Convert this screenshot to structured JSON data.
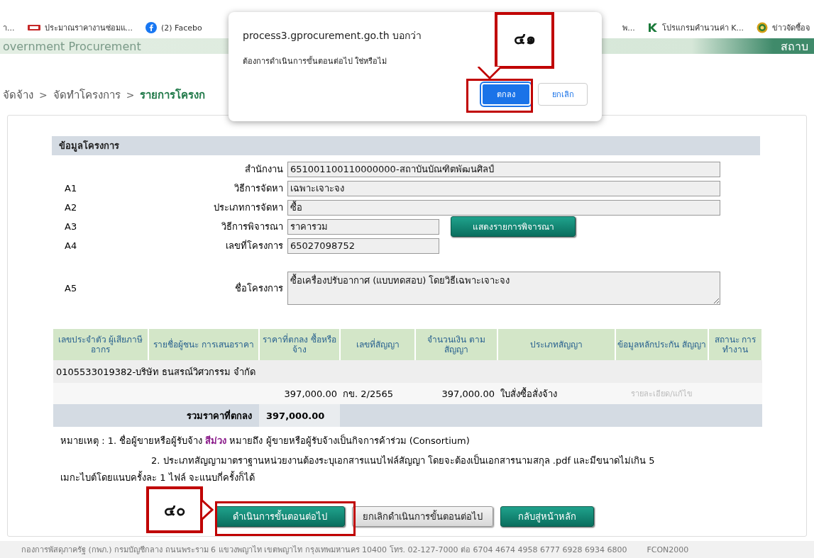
{
  "bookmarks": [
    {
      "label": "า..."
    },
    {
      "label": "ประมาณราคางานซ่อมแ..."
    },
    {
      "label": "(2) Facebo"
    },
    {
      "label": "พ..."
    },
    {
      "label": "โปรแกรมคำนวนค่า K..."
    },
    {
      "label": "ข่าวจัดซื้อจ"
    }
  ],
  "header": {
    "title": "overnment Procurement",
    "right_text": "สถาบ"
  },
  "breadcrumb": [
    {
      "label": "จัดจ้าง",
      "current": false
    },
    {
      "label": ">",
      "kind": "separator"
    },
    {
      "label": "จัดทำโครงการ",
      "current": false
    },
    {
      "label": ">",
      "kind": "separator"
    },
    {
      "label": "รายการโครงก",
      "current": true
    }
  ],
  "section": {
    "title": "ข้อมูลโครงการ"
  },
  "fields": [
    {
      "label": "สำนักงาน",
      "value": "651001100110000000-สถาบันบัณฑิตพัฒนศิลป์",
      "kind": "wide"
    },
    {
      "code": "A1",
      "label": "วิธีการจัดหา",
      "value": "เฉพาะเจาะจง",
      "kind": "wide"
    },
    {
      "code": "A2",
      "label": "ประเภทการจัดหา",
      "value": "ซื้อ",
      "kind": "wide"
    },
    {
      "code": "A3",
      "label": "วิธีการพิจารณา",
      "value": "ราคารวม",
      "kind": "short",
      "button": "แสดงรายการพิจารณา"
    },
    {
      "code": "A4",
      "label": "เลขที่โครงการ",
      "value": "65027098752",
      "kind": "short"
    },
    {
      "code": "A5",
      "label": "ชื่อโครงการ",
      "value": "ซื้อเครื่องปรับอากาศ (แบบทดสอบ) โดยวิธีเฉพาะเจาะจง",
      "kind": "textarea"
    }
  ],
  "table": {
    "columns": [
      "เลขประจำตัว ผู้เสียภาษีอากร",
      "รายชื่อผู้ชนะ การเสนอราคา",
      "ราคาที่ตกลง ซื้อหรือจ้าง",
      "เลขที่สัญญา",
      "จำนวนเงิน ตามสัญญา",
      "ประเภทสัญญา",
      "ข้อมูลหลักประกัน สัญญา",
      "สถานะ การทำงาน"
    ],
    "vendor": "0105533019382-บริษัท ธนสรณ์วิศวกรรม จำกัด",
    "row": {
      "price": "397,000.00",
      "contract_no": "กข. 2/2565",
      "amount": "397,000.00",
      "contract_type": "ใบสั่งซื้อสั่งจ้าง",
      "link": "รายละเอียด/แก้ไข",
      "link_disabled": true
    },
    "total_label": "รวมราคาที่ตกลง",
    "total": "397,000.00"
  },
  "notes": [
    {
      "parts": [
        {
          "text": "หมายเหตุ : 1. ชื่อผู้ขายหรือผู้รับจ้าง ",
          "emphasis": false
        },
        {
          "text": "สีม่วง",
          "emphasis": true
        },
        {
          "text": " หมายถึง ผู้ขายหรือผู้รับจ้างเป็นกิจการค้าร่วม (Consortium)",
          "emphasis": false
        }
      ]
    },
    {
      "parts": [
        {
          "text": "2. ประเภทสัญญามาตราฐานหน่วยงานต้องระบุเอกสารแนบไฟล์สัญญา โดยจะต้องเป็นเอกสารนามสกุล .pdf และมีขนาดไม่เกิน 5 เมกะไบต์โดยแนบครั้งละ 1 ไฟล์ จะแนบกี่ครั้งก็ได้",
          "emphasis": false
        }
      ]
    }
  ],
  "buttons": [
    {
      "label": "ดำเนินการขั้นตอนต่อไป",
      "kind": "green"
    },
    {
      "label": "ยกเลิกดำเนินการขั้นตอนต่อไป",
      "kind": "gray"
    },
    {
      "label": "กลับสู่หน้าหลัก",
      "kind": "green"
    }
  ],
  "footer": {
    "address": "กองการพัสดุภาครัฐ (กพภ.) กรมบัญชีกลาง ถนนพระราม 6 แขวงพญาไท เขตพญาไท กรุงเทพมหานคร 10400 โทร. 02-127-7000 ต่อ 6704 4674 4958 6777 6928 6934 6800",
    "code": "FCON2000"
  },
  "dialog": {
    "title": "process3.gprocurement.go.th บอกว่า",
    "message": "ต้องการดำเนินการขั้นตอนต่อไป ใช่หรือไม่",
    "buttons": [
      {
        "label": "ตกลง",
        "primary": true
      },
      {
        "label": "ยกเลิก",
        "primary": false
      }
    ]
  },
  "callouts": [
    {
      "number": "๔๑"
    },
    {
      "number": "๔๐"
    }
  ]
}
